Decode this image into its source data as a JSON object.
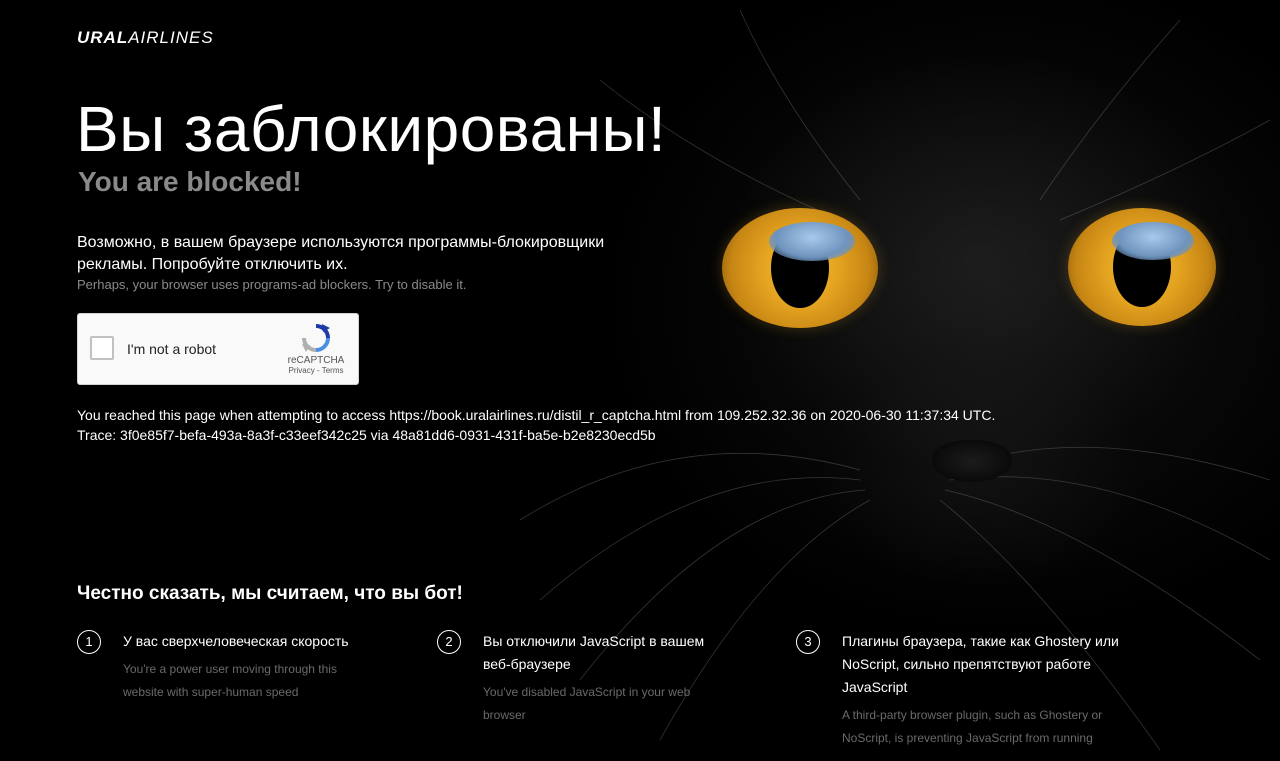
{
  "brand": {
    "logo_bold": "URAL",
    "logo_light": "AIRLINES"
  },
  "heading": {
    "title_ru": "Вы заблокированы!",
    "title_en": "You are blocked!"
  },
  "description": {
    "text_ru": "Возможно, в вашем браузере используются программы-блокировщики рекламы. Попробуйте отключить их.",
    "text_en": "Perhaps, your browser uses programs-ad blockers. Try to disable it."
  },
  "recaptcha": {
    "checkbox_label": "I'm not a robot",
    "brand": "reCAPTCHA",
    "terms": "Privacy - Terms"
  },
  "access": {
    "line1": "You reached this page when attempting to access https://book.uralairlines.ru/distil_r_captcha.html from 109.252.32.36 on 2020-06-30 11:37:34 UTC.",
    "line2": "Trace: 3f0e85f7-befa-493a-8a3f-c33eef342c25 via 48a81dd6-0931-431f-ba5e-b2e8230ecd5b"
  },
  "bot_section": {
    "title": "Честно сказать, мы считаем, что вы бот!",
    "reasons": [
      {
        "number": "1",
        "text_ru": "У вас сверхчеловеческая скорость",
        "text_en": "You're a power user moving through this website with super-human speed"
      },
      {
        "number": "2",
        "text_ru": "Вы отключили JavaScript в вашем веб-браузере",
        "text_en": "You've disabled JavaScript in your web browser"
      },
      {
        "number": "3",
        "text_ru": "Плагины браузера, такие как Ghostery или NoScript, сильно препятствуют работе JavaScript",
        "text_en": "A third-party browser plugin, such as Ghostery or NoScript, is preventing JavaScript from running"
      }
    ]
  },
  "colors": {
    "background": "#000000",
    "text_primary": "#ffffff",
    "text_secondary": "#8a8a8a",
    "text_muted": "#6a6a6a",
    "eye_color": "#e3a21f"
  }
}
